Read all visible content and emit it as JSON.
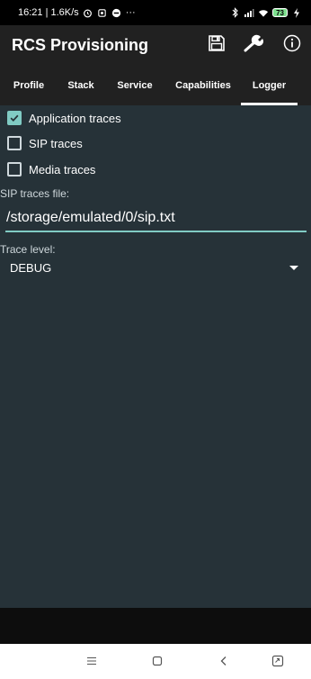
{
  "status_bar": {
    "time_speed": "16:21 | 1.6K/s",
    "more": "···",
    "network": "4G",
    "battery_level": "73"
  },
  "app_bar": {
    "title": "RCS Provisioning",
    "save_icon": "save-icon",
    "settings_icon": "wrench-icon",
    "info_icon": "info-icon"
  },
  "tabs": [
    {
      "label": "Profile",
      "active": false
    },
    {
      "label": "Stack",
      "active": false
    },
    {
      "label": "Service",
      "active": false
    },
    {
      "label": "Capabilities",
      "active": false
    },
    {
      "label": "Logger",
      "active": true
    }
  ],
  "logger": {
    "application_traces": {
      "label": "Application traces",
      "checked": true
    },
    "sip_traces": {
      "label": "SIP traces",
      "checked": false
    },
    "media_traces": {
      "label": "Media traces",
      "checked": false
    },
    "sip_traces_file": {
      "label": "SIP traces file:",
      "value": "/storage/emulated/0/sip.txt"
    },
    "trace_level": {
      "label": "Trace level:",
      "value": "DEBUG"
    }
  },
  "colors": {
    "accent": "#80cbc4",
    "background": "#263238",
    "toolbar": "#212121"
  }
}
